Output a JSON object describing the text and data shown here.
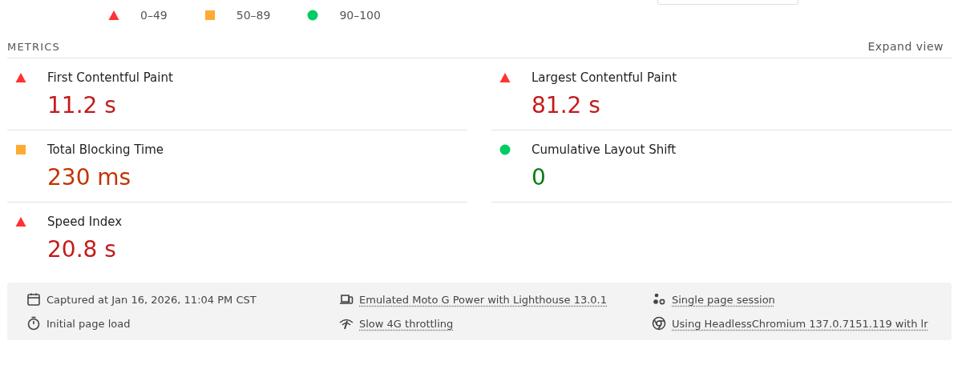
{
  "legend": [
    {
      "kind": "fail",
      "label": "0–49"
    },
    {
      "kind": "average",
      "label": "50–89"
    },
    {
      "kind": "pass",
      "label": "90–100"
    }
  ],
  "metrics": {
    "title": "METRICS",
    "toggle": "Expand view",
    "items": [
      {
        "kind": "fail",
        "label": "First Contentful Paint",
        "value": "11.2 s"
      },
      {
        "kind": "fail",
        "label": "Largest Contentful Paint",
        "value": "81.2 s"
      },
      {
        "kind": "average",
        "label": "Total Blocking Time",
        "value": "230 ms"
      },
      {
        "kind": "pass",
        "label": "Cumulative Layout Shift",
        "value": "0"
      },
      {
        "kind": "fail",
        "label": "Speed Index",
        "value": "20.8 s"
      }
    ]
  },
  "runtime": [
    {
      "kind": "calendar",
      "text": "Captured at Jan 16, 2026, 11:04 PM CST",
      "underlined": false
    },
    {
      "kind": "devices",
      "text": "Emulated Moto G Power with Lighthouse 13.0.1",
      "underlined": true
    },
    {
      "kind": "dots",
      "text": "Single page session",
      "underlined": true
    },
    {
      "kind": "timer",
      "text": "Initial page load",
      "underlined": false
    },
    {
      "kind": "signal",
      "text": "Slow 4G throttling",
      "underlined": true
    },
    {
      "kind": "chrome",
      "text": "Using HeadlessChromium 137.0.7151.119 with lr",
      "underlined": true
    }
  ]
}
